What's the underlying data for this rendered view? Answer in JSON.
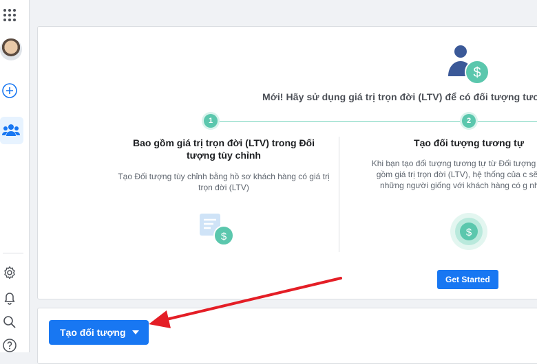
{
  "rail": {
    "icons": [
      "apps-grid-icon",
      "profile-avatar",
      "plus-circle-icon",
      "audiences-icon",
      "gear-icon",
      "bell-icon",
      "search-icon",
      "help-icon"
    ]
  },
  "promo": {
    "headline": "Mới! Hãy sử dụng giá trị trọn đời (LTV) để có đối tượng tươi",
    "step1": {
      "number": "1",
      "title": "Bao gồm giá trị trọn đời (LTV) trong Đối tượng tùy chỉnh",
      "description": "Tạo Đối tượng tùy chỉnh bằng hồ sơ khách hàng có giá trị trọn đời (LTV)"
    },
    "step2": {
      "number": "2",
      "title": "Tạo đối tượng tương tự",
      "description": "Khi bạn tạo đối tượng tương tự từ Đối tượng t bao gồm giá trị trọn đời (LTV), hệ thống của c sẽ tìm những người giống với khách hàng có g nhất."
    },
    "cta_label": "Get Started"
  },
  "actions": {
    "create_audience_label": "Tạo đối tượng"
  },
  "colors": {
    "primary": "#1877f2",
    "accent_teal": "#5bc7ad",
    "annotation_arrow": "#e41e26"
  }
}
